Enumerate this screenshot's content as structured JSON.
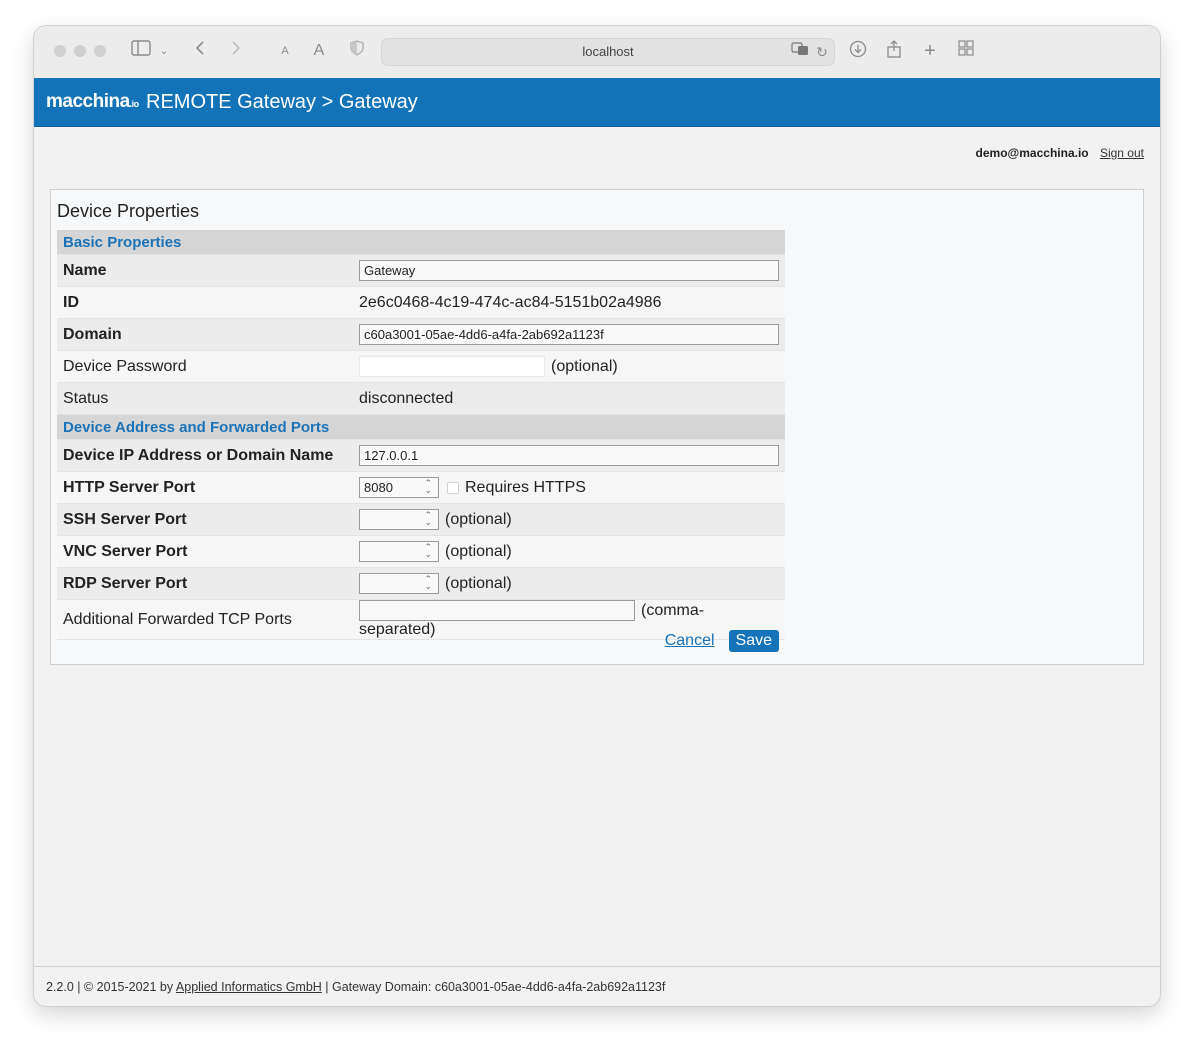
{
  "browser": {
    "url": "localhost"
  },
  "header": {
    "logo_main": "macchina",
    "logo_sub": ".io",
    "title": "REMOTE Gateway > Gateway"
  },
  "userbar": {
    "user": "demo@macchina.io",
    "signout": "Sign out"
  },
  "panel": {
    "title": "Device Properties",
    "sections": {
      "basic": "Basic Properties",
      "address": "Device Address and Forwarded Ports"
    },
    "fields": {
      "name": {
        "label": "Name",
        "value": "Gateway"
      },
      "id": {
        "label": "ID",
        "value": "2e6c0468-4c19-474c-ac84-5151b02a4986"
      },
      "domain": {
        "label": "Domain",
        "value": "c60a3001-05ae-4dd6-a4fa-2ab692a1123f"
      },
      "password": {
        "label": "Device Password",
        "value": "",
        "hint": "(optional)"
      },
      "status": {
        "label": "Status",
        "value": "disconnected"
      },
      "ip": {
        "label": "Device IP Address or Domain Name",
        "value": "127.0.0.1"
      },
      "http": {
        "label": "HTTP Server Port",
        "value": "8080",
        "checkbox_label": "Requires HTTPS"
      },
      "ssh": {
        "label": "SSH Server Port",
        "value": "",
        "hint": "(optional)"
      },
      "vnc": {
        "label": "VNC Server Port",
        "value": "",
        "hint": "(optional)"
      },
      "rdp": {
        "label": "RDP Server Port",
        "value": "",
        "hint": "(optional)"
      },
      "tcp": {
        "label": "Additional Forwarded TCP Ports",
        "value": "",
        "hint": "(comma-separated)"
      }
    },
    "buttons": {
      "cancel": "Cancel",
      "save": "Save"
    }
  },
  "footer": {
    "version": "2.2.0 | © 2015-2021 by ",
    "company": "Applied Informatics GmbH",
    "domain": " | Gateway Domain: c60a3001-05ae-4dd6-a4fa-2ab692a1123f"
  }
}
